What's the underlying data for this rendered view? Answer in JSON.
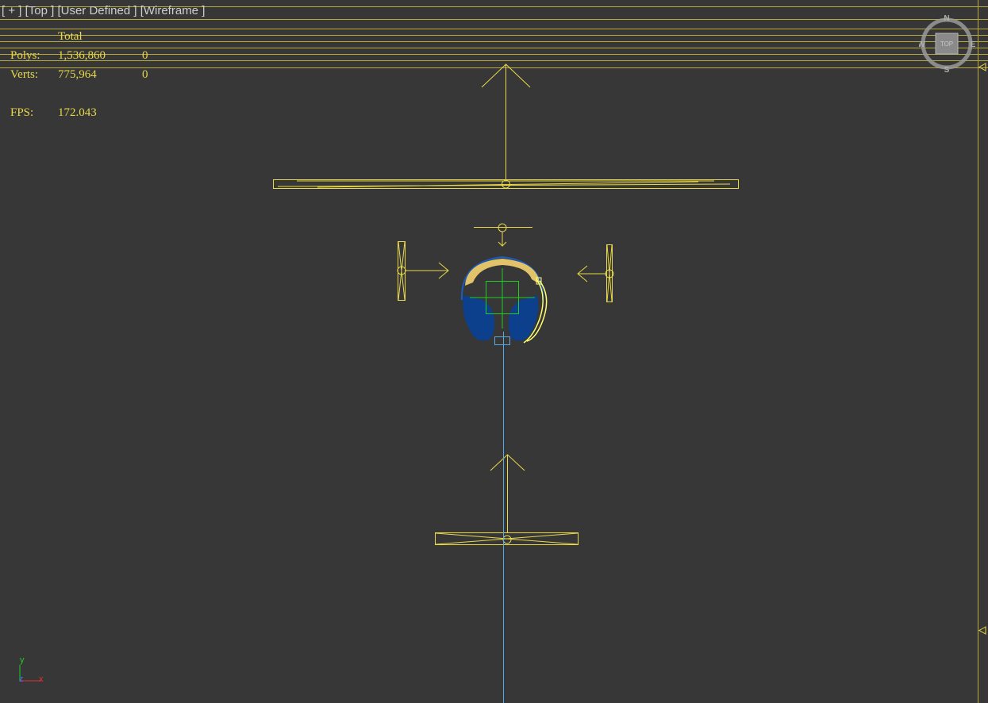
{
  "viewport": {
    "labels": [
      "[ + ]",
      "[Top ]",
      "[User Defined ]",
      "[Wireframe ]"
    ]
  },
  "stats": {
    "header": "Total",
    "polys_label": "Polys:",
    "polys_total": "1,536,860",
    "polys_selected": "0",
    "verts_label": "Verts:",
    "verts_total": "775,964",
    "verts_selected": "0",
    "fps_label": "FPS:",
    "fps_value": "172.043"
  },
  "viewcube": {
    "face_label": "TOP",
    "north": "N",
    "south": "S",
    "east": "E",
    "west": "W"
  },
  "axis_triad": {
    "y": "y",
    "z": "z",
    "x": "x"
  },
  "colors": {
    "background": "#373737",
    "wireframe": "#e8d84a",
    "selection": "#22cc22",
    "camera_line": "#5aa8e0",
    "headphone_band": "#e3c36a",
    "headphone_cups": "#0c3f8c"
  }
}
